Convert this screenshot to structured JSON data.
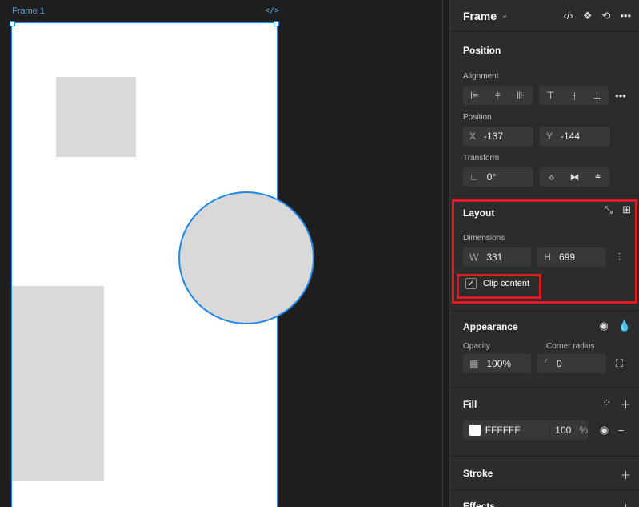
{
  "canvas": {
    "frame_label": "Frame 1",
    "code_badge": "</>"
  },
  "panel": {
    "title": "Frame",
    "header_icons": [
      "code-icon",
      "component-icon",
      "variants-icon",
      "more-icon"
    ],
    "position": {
      "title": "Position",
      "alignment_label": "Alignment",
      "position_label": "Position",
      "x_label": "X",
      "x_value": "-137",
      "y_label": "Y",
      "y_value": "-144",
      "transform_label": "Transform",
      "rotation_value": "0°"
    },
    "layout": {
      "title": "Layout",
      "dimensions_label": "Dimensions",
      "w_label": "W",
      "w_value": "331",
      "h_label": "H",
      "h_value": "699",
      "clip_label": "Clip content"
    },
    "appearance": {
      "title": "Appearance",
      "opacity_label": "Opacity",
      "opacity_value": "100%",
      "corner_label": "Corner radius",
      "corner_value": "0"
    },
    "fill": {
      "title": "Fill",
      "hex": "FFFFFF",
      "opacity": "100",
      "unit": "%"
    },
    "stroke": {
      "title": "Stroke"
    },
    "effects": {
      "title": "Effects"
    }
  },
  "colors": {
    "selection": "#1e88e5",
    "highlight": "#e01b24",
    "panel_bg": "#2c2c2c",
    "shape_fill": "#d9d9d9"
  }
}
